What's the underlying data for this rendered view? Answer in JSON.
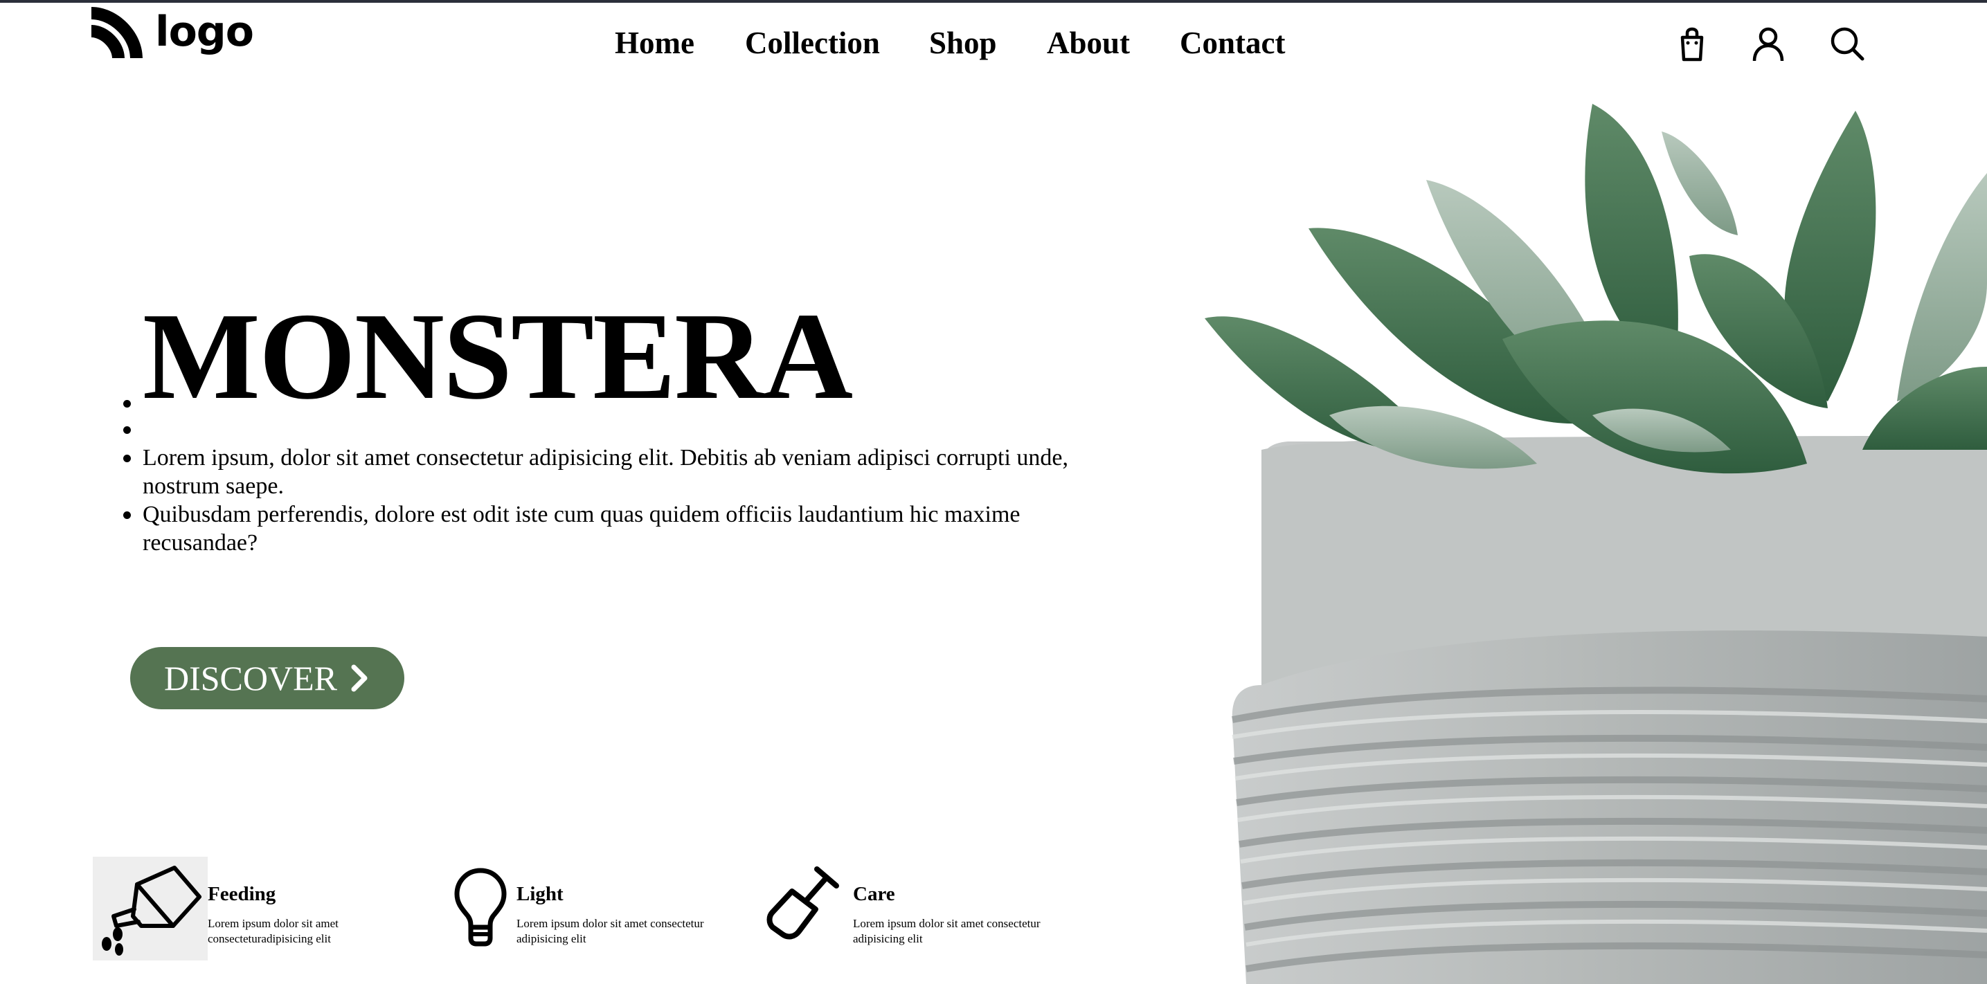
{
  "brand": {
    "logo_text": "logo"
  },
  "nav": {
    "items": [
      "Home",
      "Collection",
      "Shop",
      "About",
      "Contact"
    ]
  },
  "header_icons": [
    "shopping-bag-icon",
    "user-icon",
    "search-icon"
  ],
  "hero": {
    "title": "MONSTERA",
    "paragraphs": [
      "Lorem ipsum, dolor sit amet consectetur adipisicing elit. Debitis ab veniam adipisci corrupti unde, nostrum saepe.",
      "Quibusdam perferendis, dolore est odit iste cum quas quidem officiis laudantium hic maxime recusandae?"
    ],
    "button_label": "DISCOVER",
    "button_color": "#557452"
  },
  "features": [
    {
      "title": "Feeding",
      "description": "Lorem ipsum dolor sit amet consecteturadipisicing elit",
      "icon": "watering-can-icon"
    },
    {
      "title": "Light",
      "description": "Lorem ipsum dolor sit amet consectetur adipisicing elit",
      "icon": "light-bulb-icon"
    },
    {
      "title": "Care",
      "description": "Lorem ipsum dolor sit amet consectetur adipisicing elit",
      "icon": "shovel-icon"
    }
  ]
}
